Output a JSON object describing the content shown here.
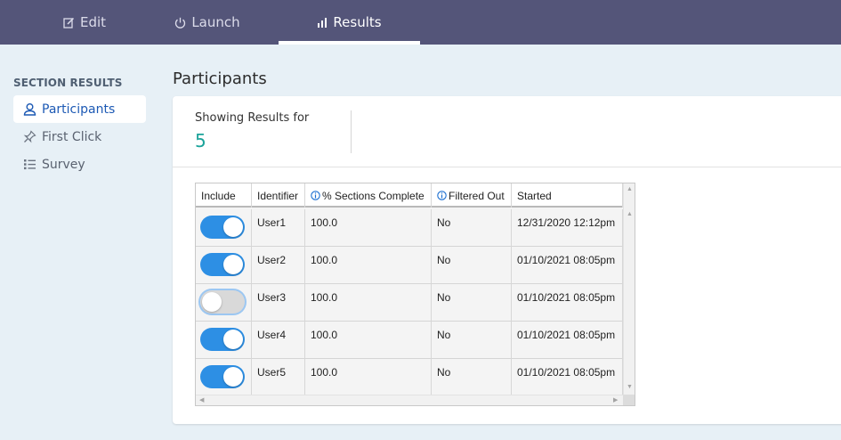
{
  "topnav": {
    "tabs": [
      {
        "label": "Edit",
        "icon": "edit-icon"
      },
      {
        "label": "Launch",
        "icon": "power-icon"
      },
      {
        "label": "Results",
        "icon": "bar-chart-icon",
        "active": true
      }
    ]
  },
  "sidebar": {
    "heading": "SECTION RESULTS",
    "items": [
      {
        "label": "Participants",
        "icon": "user-icon",
        "active": true
      },
      {
        "label": "First Click",
        "icon": "pin-icon"
      },
      {
        "label": "Survey",
        "icon": "list-icon"
      }
    ]
  },
  "main": {
    "title": "Participants",
    "summary": {
      "label": "Showing Results for",
      "value": "5"
    },
    "table": {
      "columns": [
        "Include",
        "Identifier",
        "% Sections Complete",
        "Filtered Out",
        "Started"
      ],
      "rows": [
        {
          "include": true,
          "identifier": "User1",
          "sections_complete": "100.0",
          "filtered_out": "No",
          "started": "12/31/2020 12:12pm"
        },
        {
          "include": true,
          "identifier": "User2",
          "sections_complete": "100.0",
          "filtered_out": "No",
          "started": "01/10/2021 08:05pm"
        },
        {
          "include": false,
          "identifier": "User3",
          "sections_complete": "100.0",
          "filtered_out": "No",
          "started": "01/10/2021 08:05pm"
        },
        {
          "include": true,
          "identifier": "User4",
          "sections_complete": "100.0",
          "filtered_out": "No",
          "started": "01/10/2021 08:05pm"
        },
        {
          "include": true,
          "identifier": "User5",
          "sections_complete": "100.0",
          "filtered_out": "No",
          "started": "01/10/2021 08:05pm"
        }
      ]
    }
  },
  "colors": {
    "nav_bg": "#545579",
    "accent": "#1c59b4",
    "toggle_on": "#2d8fe4",
    "count": "#1aa39a"
  }
}
